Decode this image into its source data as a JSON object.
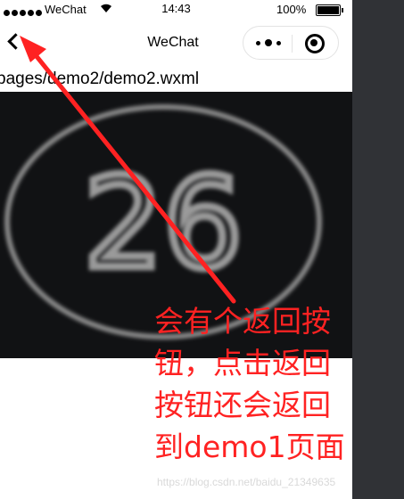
{
  "status_bar": {
    "carrier": "WeChat",
    "time": "14:43",
    "battery_percent_label": "100%",
    "battery_level": 1.0
  },
  "nav": {
    "title": "WeChat",
    "back_icon": "chevron-left-icon",
    "more_icon": "more-dots-icon",
    "close_icon": "target-close-icon"
  },
  "page": {
    "path": "pages/demo2/demo2.wxml",
    "image_number": "26"
  },
  "annotation": {
    "lines": [
      "会有个返回按",
      "钮，点击返回",
      "按钮还会返回",
      "到demo1页面"
    ],
    "color": "#ff2222"
  },
  "watermark": "https://blog.csdn.net/baidu_21349635"
}
